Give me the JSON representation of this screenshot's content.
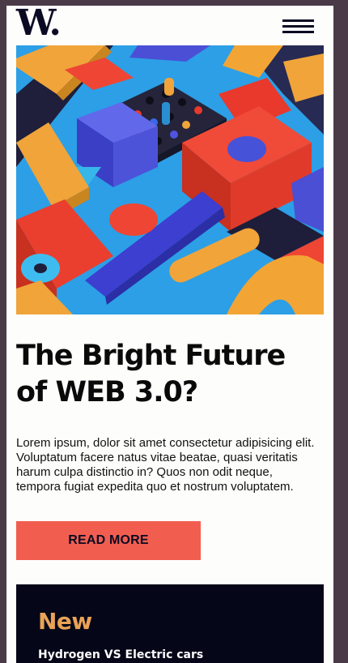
{
  "brand": {
    "logo_text": "W."
  },
  "header": {
    "menu_icon": "hamburger-menu-icon"
  },
  "hero": {
    "image": "abstract-3d-colorful-blocks"
  },
  "article": {
    "title": "The Bright Future of WEB 3.0?",
    "excerpt": "Lorem ipsum, dolor sit amet consectetur adipisicing elit. Voluptatum facere natus vitae beatae, quasi veritatis harum culpa distinctio in? Quos non odit neque, tempora fugiat expedita quo et nostrum voluptatem.",
    "cta_label": "READ MORE"
  },
  "new_section": {
    "heading": "New",
    "items": [
      "Hydrogen VS Electric cars"
    ]
  },
  "colors": {
    "page_bg": "#4a3a48",
    "content_bg": "#fdfdfc",
    "text_dark": "#0b0a23",
    "accent_red": "#f15e50",
    "accent_orange": "#e9a256",
    "panel_dark": "#050718"
  }
}
